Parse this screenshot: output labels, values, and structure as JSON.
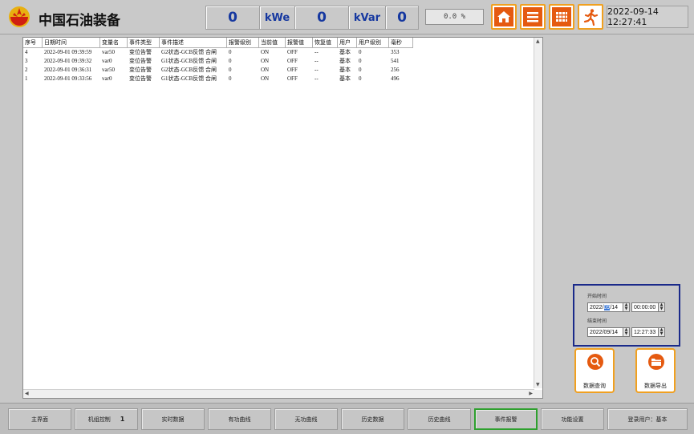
{
  "header": {
    "title": "中国石油装备",
    "active_power_value": "0",
    "active_power_unit": "kWe",
    "reactive_power_value": "0",
    "reactive_power_unit": "kVar",
    "extra_value": "0",
    "percent_text": "0.0  %",
    "datetime": "2022-09-14 12:27:41",
    "icons": [
      "home-icon",
      "menu-icon",
      "grid-icon",
      "exit-icon"
    ]
  },
  "table": {
    "columns": [
      "序号",
      "日期时间",
      "变量名",
      "事件类型",
      "事件描述",
      "报警级别",
      "当前值",
      "报警值",
      "恢复值",
      "用户",
      "用户级别",
      "毫秒"
    ],
    "rows": [
      [
        "4",
        "2022-09-01 09:39:59",
        "var50",
        "变位告警",
        "G2状态-GCB反馈 合闸",
        "0",
        "ON",
        "OFF",
        "--",
        "基本",
        "0",
        "353"
      ],
      [
        "3",
        "2022-09-01 09:39:32",
        "var0",
        "变位告警",
        "G1状态-GCB反馈 合闸",
        "0",
        "ON",
        "OFF",
        "--",
        "基本",
        "0",
        "541"
      ],
      [
        "2",
        "2022-09-01 09:36:31",
        "var50",
        "变位告警",
        "G2状态-GCB反馈 合闸",
        "0",
        "ON",
        "OFF",
        "--",
        "基本",
        "0",
        "256"
      ],
      [
        "1",
        "2022-09-01 09:33:56",
        "var0",
        "变位告警",
        "G1状态-GCB反馈 合闸",
        "0",
        "ON",
        "OFF",
        "--",
        "基本",
        "0",
        "496"
      ]
    ]
  },
  "date_filter": {
    "start_label": "开始时间",
    "start_date_pre": "2022/",
    "start_date_sel": "09",
    "start_date_post": "/14",
    "start_time": "00:00:00",
    "end_label": "结束时间",
    "end_date": "2022/09/14",
    "end_time": "12:27:33"
  },
  "actions": {
    "query_label": "数据查询",
    "export_label": "数据导出"
  },
  "nav": [
    {
      "label": "主界面"
    },
    {
      "label": "机组控制",
      "badge": "1"
    },
    {
      "label": "实时数据"
    },
    {
      "label": "有功曲线"
    },
    {
      "label": "无功曲线"
    },
    {
      "label": "历史数据"
    },
    {
      "label": "历史曲线"
    },
    {
      "label": "事件报警",
      "active": true
    },
    {
      "label": "功能设置"
    },
    {
      "label": "登录用户：基本"
    }
  ],
  "colors": {
    "accent_orange": "#e55a10",
    "button_border": "#f0a020",
    "value_blue": "#1638a0",
    "active_nav_border": "#2ea02e",
    "date_panel_border": "#1a2a8a"
  }
}
